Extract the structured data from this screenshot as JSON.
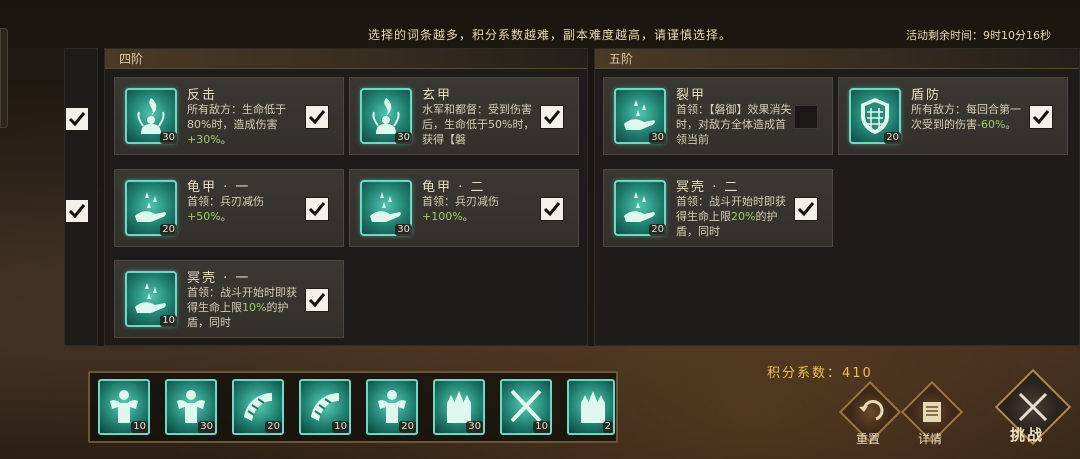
{
  "header": {
    "note": "选择的词条越多，积分系数越难，副本难度越高，请谨慎选择。",
    "time_remaining": "活动剩余时间：9时10分16秒"
  },
  "tiers": [
    {
      "label": "四阶",
      "cards": [
        {
          "title": "反击",
          "desc_pre": "所有敌方：生命低于80%时，造成伤害",
          "desc_green": "+30%",
          "desc_post": "。",
          "level": "30",
          "checked": true,
          "icon": "flame-figure-icon"
        },
        {
          "title": "玄甲",
          "desc_pre": "水军和都督：受到伤害后，生命低于50%时，获得【磐",
          "desc_green": "",
          "desc_post": "",
          "level": "30",
          "checked": true,
          "icon": "flame-figure-icon"
        },
        {
          "title": "龟甲 · 一",
          "desc_pre": "首领：兵刃减伤",
          "desc_green": "+50%",
          "desc_post": "。",
          "level": "20",
          "checked": true,
          "icon": "water-hand-icon"
        },
        {
          "title": "龟甲 · 二",
          "desc_pre": "首领：兵刃减伤",
          "desc_green": "+100%",
          "desc_post": "。",
          "level": "30",
          "checked": true,
          "icon": "water-hand-icon"
        },
        {
          "title": "冥壳 · 一",
          "desc_pre": "首领：战斗开始时即获得生命上限",
          "desc_green": "10%",
          "desc_post": "的护盾，同时",
          "level": "10",
          "checked": true,
          "icon": "water-hand-icon"
        }
      ]
    },
    {
      "label": "五阶",
      "cards": [
        {
          "title": "裂甲",
          "desc_pre": "首领：【磐御】效果消失时，对敌方全体造成首领当前",
          "desc_green": "",
          "desc_post": "",
          "level": "30",
          "checked": false,
          "icon": "water-hand-icon"
        },
        {
          "title": "盾防",
          "desc_pre": "所有敌方：每回合第一次受到的伤害",
          "desc_green": "-60%",
          "desc_post": "。",
          "level": "20",
          "checked": true,
          "icon": "shield-icon"
        },
        {
          "title": "冥壳 · 二",
          "desc_pre": "首领：战斗开始时即获得生命上限",
          "desc_green": "20%",
          "desc_post": "的护盾，同时",
          "level": "20",
          "checked": true,
          "icon": "water-hand-icon"
        }
      ]
    }
  ],
  "enemy_units": [
    {
      "icon": "muscle-soldier-icon",
      "level": "10"
    },
    {
      "icon": "muscle-soldier-icon",
      "level": "30"
    },
    {
      "icon": "horn-icon",
      "level": "20"
    },
    {
      "icon": "horn-icon",
      "level": "10"
    },
    {
      "icon": "muscle-soldier-icon",
      "level": "20"
    },
    {
      "icon": "troops-icon",
      "level": "30"
    },
    {
      "icon": "crossed-swords-icon",
      "level": "10"
    },
    {
      "icon": "troops-icon",
      "level": "2"
    }
  ],
  "score": {
    "label": "积分系数：",
    "value": "410"
  },
  "actions": {
    "reset": "重置",
    "details": "详情",
    "challenge": "挑战"
  },
  "colors": {
    "accent_teal": "#4fc5ae",
    "green_text": "#9fce6a",
    "gold": "#f0c14a"
  }
}
